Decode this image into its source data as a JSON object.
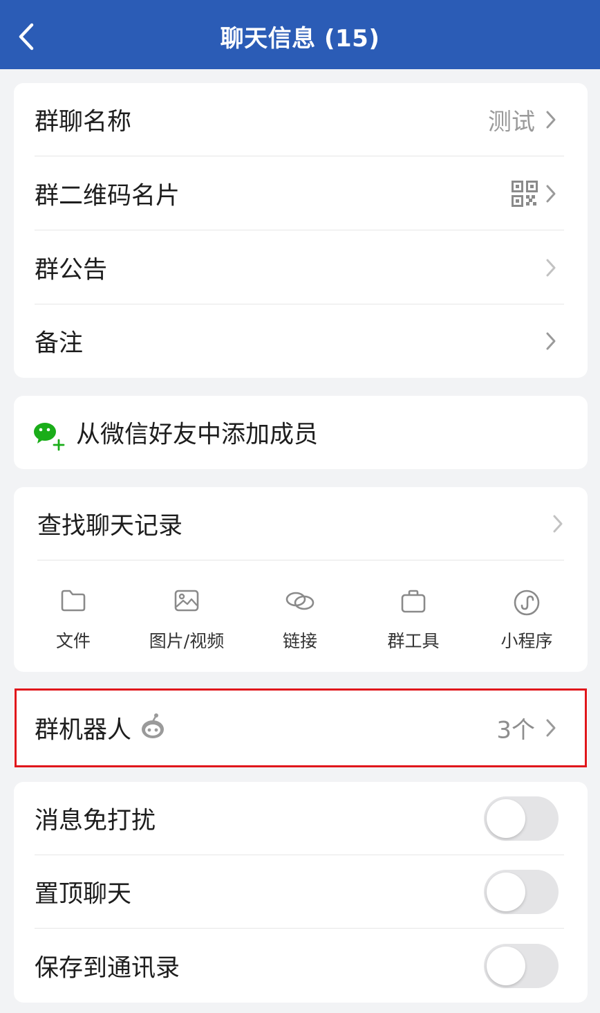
{
  "header": {
    "title": "聊天信息 (15)"
  },
  "group_info": {
    "name_label": "群聊名称",
    "name_value": "测试",
    "qrcode_label": "群二维码名片",
    "notice_label": "群公告",
    "remark_label": "备注"
  },
  "add_member": {
    "label": "从微信好友中添加成员"
  },
  "search": {
    "label": "查找聊天记录",
    "tools": [
      {
        "label": "文件",
        "icon": "folder-icon"
      },
      {
        "label": "图片/视频",
        "icon": "image-icon"
      },
      {
        "label": "链接",
        "icon": "link-icon"
      },
      {
        "label": "群工具",
        "icon": "briefcase-icon"
      },
      {
        "label": "小程序",
        "icon": "mini-program-icon"
      }
    ]
  },
  "robot": {
    "label": "群机器人",
    "count": "3个"
  },
  "settings": {
    "mute_label": "消息免打扰",
    "mute_on": false,
    "pin_label": "置顶聊天",
    "pin_on": false,
    "save_label": "保存到通讯录",
    "save_on": false
  },
  "colors": {
    "nav_bg": "#2b5cb6",
    "page_bg": "#f2f3f5",
    "wechat_green": "#1aad19",
    "highlight_red": "#e0161b"
  }
}
